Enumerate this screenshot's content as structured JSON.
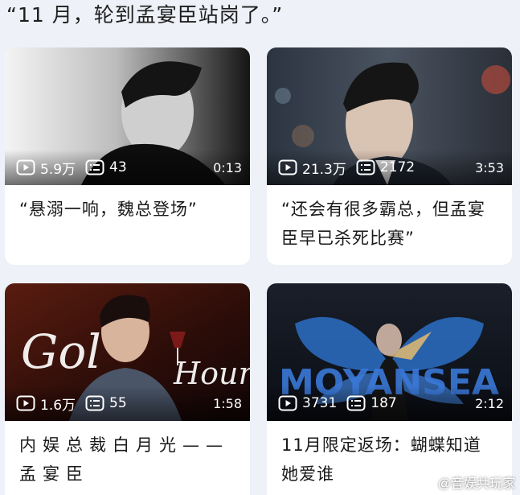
{
  "header": {
    "caption": "“11 月，轮到孟宴臣站岗了。”"
  },
  "cards": [
    {
      "views": "5.9万",
      "comments": "43",
      "duration": "0:13",
      "title": "“悬溺一响，魏总登场”"
    },
    {
      "views": "21.3万",
      "comments": "2172",
      "duration": "3:53",
      "title": "“还会有很多霸总，但孟宴臣早已杀死比赛”"
    },
    {
      "views": "1.6万",
      "comments": "55",
      "duration": "1:58",
      "title": "内娱总裁白月光——孟宴臣",
      "overlay_text": "Golden Hour"
    },
    {
      "views": "3731",
      "comments": "187",
      "duration": "2:12",
      "title": "11月限定返场：蝴蝶知道她爱谁",
      "overlay_text": "MOYANSEA"
    }
  ],
  "icons": {
    "play": "play-icon",
    "comments": "comment-list-icon",
    "watermark": "weibo-logo-icon"
  },
  "watermark": {
    "text": "@音娱共玩家"
  }
}
